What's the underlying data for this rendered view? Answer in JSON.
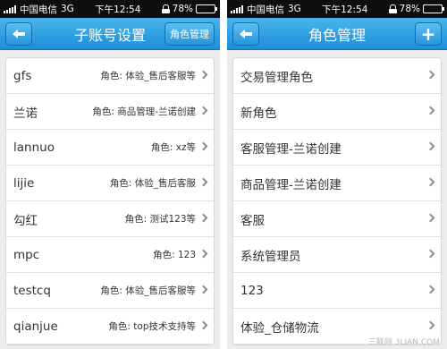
{
  "status_bar": {
    "carrier": "中国电信",
    "network": "3G",
    "time": "下午12:54",
    "battery": "78%",
    "battery_level": 0.78
  },
  "left_screen": {
    "title": "子账号设置",
    "right_button": "角色管理",
    "accounts": [
      {
        "name": "gfs",
        "role": "角色: 体验_售后客服等"
      },
      {
        "name": "兰诺",
        "role": "角色: 商品管理-兰诺创建"
      },
      {
        "name": "lannuo",
        "role": "角色: xz等"
      },
      {
        "name": "lijie",
        "role": "角色: 体验_售后客服"
      },
      {
        "name": "勾红",
        "role": "角色: 测试123等"
      },
      {
        "name": "mpc",
        "role": "角色: 123"
      },
      {
        "name": "testcq",
        "role": "角色: 体验_售后客服等"
      },
      {
        "name": "qianjue",
        "role": "角色: top技术支持等"
      }
    ]
  },
  "right_screen": {
    "title": "角色管理",
    "add_button": "+",
    "roles": [
      "交易管理角色",
      "新角色",
      "客服管理-兰诺创建",
      "商品管理-兰诺创建",
      "客服",
      "系统管理员",
      "123",
      "体验_仓储物流"
    ]
  },
  "watermark": "三联网 3LIAN.COM"
}
